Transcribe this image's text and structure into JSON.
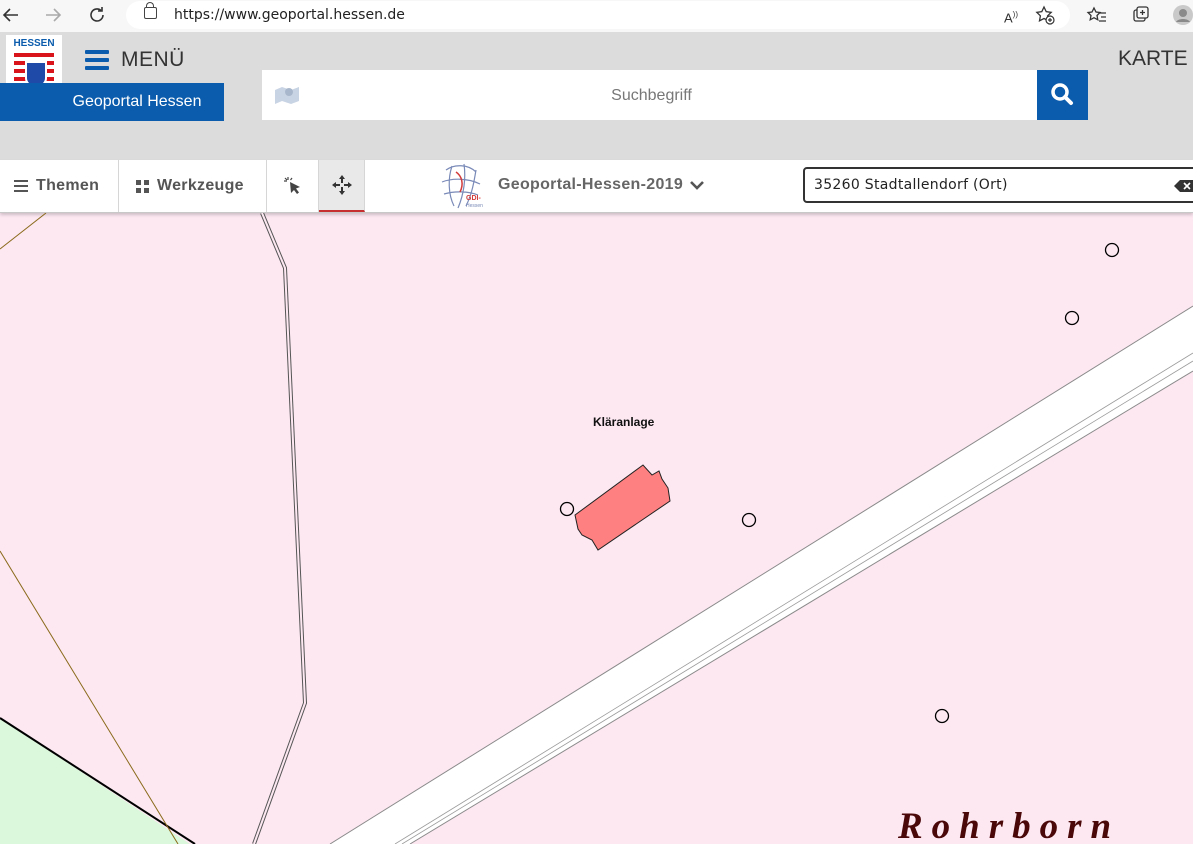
{
  "browser": {
    "url": "https://www.geoportal.hessen.de",
    "icons": [
      "back-icon",
      "forward-icon",
      "refresh-icon",
      "lock-icon",
      "read-aloud-icon",
      "favorite-add-icon",
      "favorites-icon",
      "collections-icon",
      "profile-icon"
    ]
  },
  "header": {
    "logo_text": "HESSEN",
    "portal_name": "Geoportal Hessen",
    "menu_label": "MENÜ",
    "karte_label": "KARTE",
    "search_placeholder": "Suchbegriff"
  },
  "toolbar": {
    "themen_label": "Themen",
    "werkzeuge_label": "Werkzeuge",
    "mapset_label": "Geoportal-Hessen-2019",
    "gdi_logo_text": "GDI-Hessen",
    "location_value": "35260 Stadtallendorf (Ort)"
  },
  "map": {
    "labels": {
      "klaeranlage": "Kläranlage",
      "rohrborn": "Rohrborn"
    },
    "colors": {
      "background": "#fde8f2",
      "building": "#ff8080",
      "meadow": "#dcf8dc",
      "road": "#ffffff",
      "accent": "#0b5cad"
    }
  }
}
